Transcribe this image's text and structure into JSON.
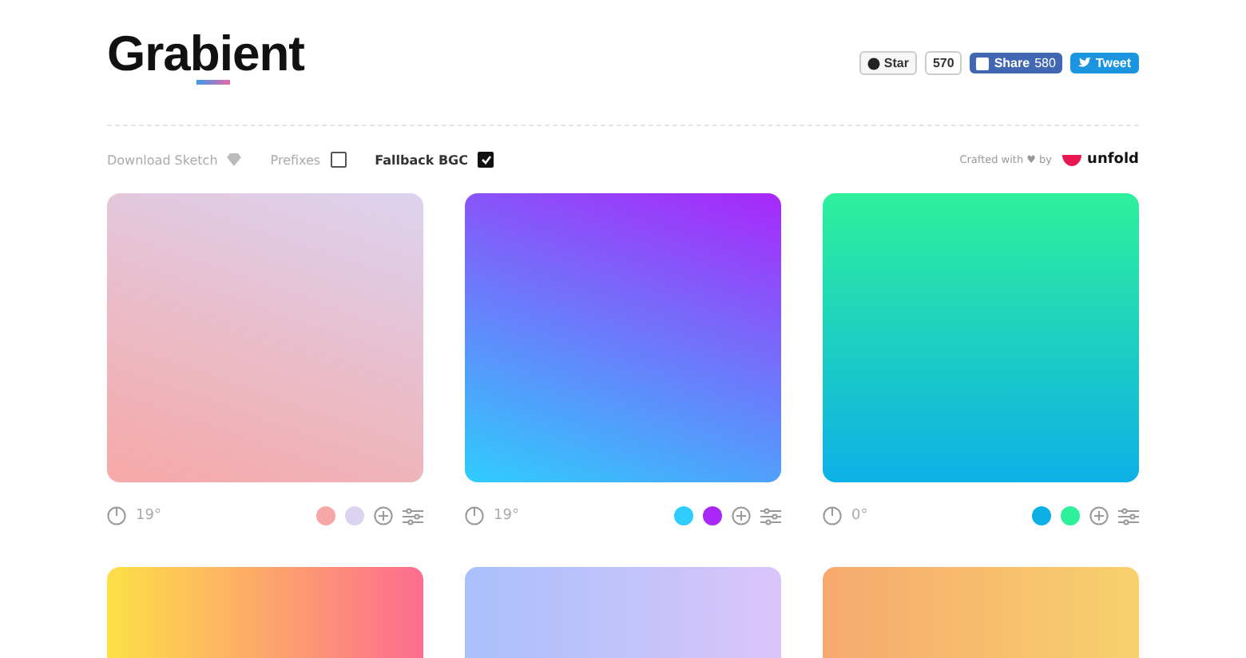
{
  "header": {
    "logo": "Grabient",
    "social": {
      "star_label": "Star",
      "star_count": "570",
      "share_label": "Share",
      "share_count": "580",
      "tweet_label": "Tweet"
    }
  },
  "toolbar": {
    "download_label": "Download Sketch",
    "options": [
      {
        "label": "Prefixes",
        "checked": false
      },
      {
        "label": "Fallback BGC",
        "checked": true
      }
    ],
    "credit": "Crafted with ♥ by",
    "brand": "unfold"
  },
  "cards": [
    {
      "angle": "19°",
      "colors": [
        {
          "color": "#f6a8a6"
        },
        {
          "color": "#dcd3f0"
        }
      ]
    },
    {
      "angle": "19°",
      "colors": [
        {
          "color": "#2fcdfd"
        },
        {
          "color": "#a927f9"
        }
      ]
    },
    {
      "angle": "0°",
      "colors": [
        {
          "color": "#0db0e6"
        },
        {
          "color": "#2df09b"
        }
      ]
    },
    {
      "colors": [
        {
          "color": "#fde046"
        },
        {
          "color": "#fc6c8f"
        }
      ]
    },
    {
      "colors": [
        {
          "color": "#a8c0fb"
        },
        {
          "color": "#dac5fa"
        }
      ]
    },
    {
      "colors": [
        {
          "color": "#f6a96f"
        },
        {
          "color": "#f7d16c"
        }
      ]
    }
  ]
}
